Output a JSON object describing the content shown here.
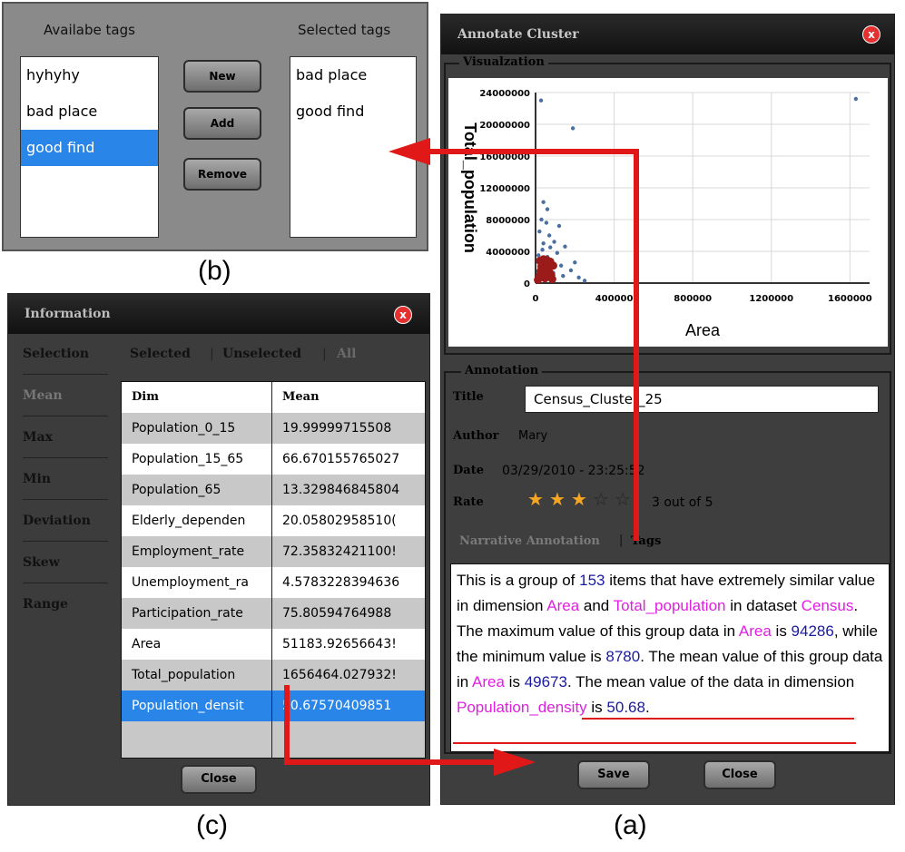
{
  "tags_panel": {
    "available_title": "Availabe tags",
    "selected_title": "Selected tags",
    "available": [
      "hyhyhy",
      "bad place",
      "good find"
    ],
    "available_selected_index": 2,
    "selected": [
      "bad place",
      "good find"
    ],
    "buttons": {
      "new": "New",
      "add": "Add",
      "remove": "Remove"
    },
    "caption": "(b)"
  },
  "info_panel": {
    "title": "Information",
    "close_x": "x",
    "sidebar": [
      "Selection",
      "Mean",
      "Max",
      "Min",
      "Deviation",
      "Skew",
      "Range"
    ],
    "tabs": {
      "selected": "Selected",
      "sep1": "|",
      "unselected": "Unselected",
      "sep2": "|",
      "all": "All"
    },
    "table": {
      "headers": [
        "Dim",
        "Mean"
      ],
      "rows": [
        [
          "Population_0_15",
          "19.99999715508"
        ],
        [
          "Population_15_65",
          "66.670155765027"
        ],
        [
          "Population_65",
          "13.329846845804"
        ],
        [
          "Elderly_dependen",
          "20.05802958510("
        ],
        [
          "Employment_rate",
          "72.35832421100!"
        ],
        [
          "Unemployment_ra",
          "4.5783228394636"
        ],
        [
          "Participation_rate",
          "75.80594764988"
        ],
        [
          "Area",
          "51183.92656643!"
        ],
        [
          "Total_population",
          "1656464.027932!"
        ],
        [
          "Population_densit",
          "50.67570409851"
        ]
      ],
      "selected_index": 9
    },
    "close_button": "Close",
    "caption": "(c)"
  },
  "annot_panel": {
    "title": "Annotate Cluster",
    "close_x": "x",
    "visualization_label": "Visualzation",
    "annotation_label": "Annotation",
    "fields": {
      "title_label": "Title",
      "title_value": "Census_Cluster_25",
      "author_label": "Author",
      "author_value": "Mary",
      "date_label": "Date",
      "date_value": "03/29/2010 - 23:25:52",
      "rate_label": "Rate",
      "rate_text": "3 out of 5"
    },
    "rating": 3,
    "rating_max": 5,
    "narrative_tabs": {
      "narrative": "Narrative Annotation",
      "sep": "|",
      "tags": "Tags"
    },
    "narrative": {
      "p1": "This is a group of ",
      "n_items": "153",
      "p2": " items that have extremely similar value in dimension ",
      "dim1": "Area",
      "p3": " and ",
      "dim2": "Total_population",
      "p4": " in dataset ",
      "dataset": "Census",
      "p5": ". The maximum value of this group data in ",
      "dim3": "Area",
      "p6": " is ",
      "max": "94286",
      "p7": ", while the minimum value is ",
      "min": "8780",
      "p8": ". The mean value of this group data in ",
      "dim4": "Area",
      "p9": " is ",
      "mean": "49673",
      "p10": ". The mean value of the data in dimension ",
      "dim5": "Population_density",
      "p11": " is ",
      "density": "50.68",
      "p12": "."
    },
    "save_button": "Save",
    "close_button": "Close",
    "caption": "(a)"
  },
  "chart_data": {
    "type": "scatter",
    "xlabel": "Area",
    "ylabel": "Total_population",
    "xlim": [
      0,
      1700000
    ],
    "ylim": [
      0,
      24000000
    ],
    "x_ticks": [
      "0",
      "400000",
      "800000",
      "1200000",
      "1600000"
    ],
    "y_ticks": [
      "0",
      "4000000",
      "8000000",
      "12000000",
      "16000000",
      "20000000",
      "24000000"
    ],
    "grid": true,
    "series": [
      {
        "color": "#4a6fa0",
        "points": [
          [
            28000,
            23000000
          ],
          [
            190000,
            19500000
          ],
          [
            1630000,
            23200000
          ],
          [
            40000,
            10200000
          ],
          [
            60000,
            9300000
          ],
          [
            30000,
            8000000
          ],
          [
            55000,
            7600000
          ],
          [
            120000,
            7200000
          ],
          [
            20000,
            6500000
          ],
          [
            70000,
            6000000
          ],
          [
            95000,
            5200000
          ],
          [
            40000,
            5000000
          ],
          [
            150000,
            4600000
          ],
          [
            110000,
            3800000
          ],
          [
            15000,
            3500000
          ],
          [
            60000,
            3300000
          ],
          [
            200000,
            2600000
          ],
          [
            130000,
            2200000
          ],
          [
            180000,
            1600000
          ],
          [
            220000,
            700000
          ],
          [
            90000,
            1300000
          ],
          [
            35000,
            4200000
          ],
          [
            75000,
            4500000
          ],
          [
            250000,
            300000
          ],
          [
            140000,
            900000
          ]
        ]
      },
      {
        "color": "#9b1a1a",
        "points": [
          [
            12000,
            400000
          ],
          [
            20000,
            900000
          ],
          [
            25000,
            1500000
          ],
          [
            30000,
            2100000
          ],
          [
            35000,
            2600000
          ],
          [
            40000,
            3000000
          ],
          [
            45000,
            2400000
          ],
          [
            50000,
            1800000
          ],
          [
            55000,
            1200000
          ],
          [
            60000,
            800000
          ],
          [
            65000,
            2000000
          ],
          [
            70000,
            1400000
          ],
          [
            75000,
            2700000
          ],
          [
            80000,
            1000000
          ],
          [
            85000,
            500000
          ],
          [
            90000,
            2200000
          ],
          [
            22000,
            2800000
          ],
          [
            48000,
            600000
          ],
          [
            58000,
            2900000
          ],
          [
            38000,
            1100000
          ]
        ]
      }
    ]
  }
}
